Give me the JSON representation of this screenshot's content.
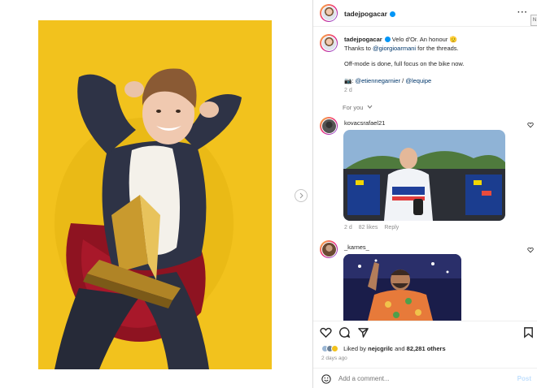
{
  "post": {
    "username": "tadejpogacar",
    "more_label": "···",
    "tooltip_tab": "N",
    "caption_line1_prefix": "Velo d'Or. An honour ",
    "caption_line1_emoji": "🫡",
    "caption_line2_prefix": "Thanks to ",
    "caption_line2_mention": "@giorgioarmani",
    "caption_line2_suffix": " for the threads.",
    "caption_line3": "Off-mode is done, full focus on the bike now.",
    "credit_prefix": "📷: ",
    "credit_mention1": "@etiennegarnier",
    "credit_sep": " / ",
    "credit_mention2": "@lequipe",
    "age": "2 d"
  },
  "comments_filter": {
    "label": "For you"
  },
  "comments": [
    {
      "username": "kovacsrafael21",
      "age": "2 d",
      "likes": "82 likes",
      "reply": "Reply"
    },
    {
      "username": "_karnes_"
    }
  ],
  "likes": {
    "prefix": "Liked by ",
    "user": "nejcgrilc",
    "middle": " and ",
    "count": "82,281 others"
  },
  "date": "2 days ago",
  "add_comment": {
    "placeholder": "Add a comment...",
    "post_label": "Post"
  },
  "colors": {
    "photo_bg": "#f2c21d",
    "link": "#00376b",
    "verified": "#0095f6",
    "muted": "#8e8e8e"
  },
  "icons": [
    "verified-icon",
    "more-icon",
    "chevron-right-icon",
    "chevron-down-icon",
    "heart-icon",
    "comment-icon",
    "share-icon",
    "bookmark-icon",
    "emoji-icon"
  ]
}
